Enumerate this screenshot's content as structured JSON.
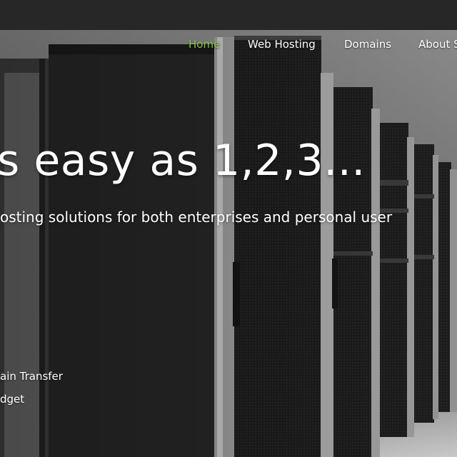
{
  "nav": {
    "items": [
      {
        "label": "Home",
        "active": true
      },
      {
        "label": "Web Hosting",
        "active": false
      },
      {
        "label": "Domains",
        "active": false
      },
      {
        "label": "About S",
        "active": false
      }
    ]
  },
  "hero": {
    "headline": "s easy as 1,2,3...",
    "subheadline": "osting solutions for both enterprises and personal user",
    "features": [
      "ain Transfer",
      "dget"
    ]
  },
  "colors": {
    "accent": "#8bc34a",
    "topbar": "#272727",
    "text": "#ffffff"
  }
}
